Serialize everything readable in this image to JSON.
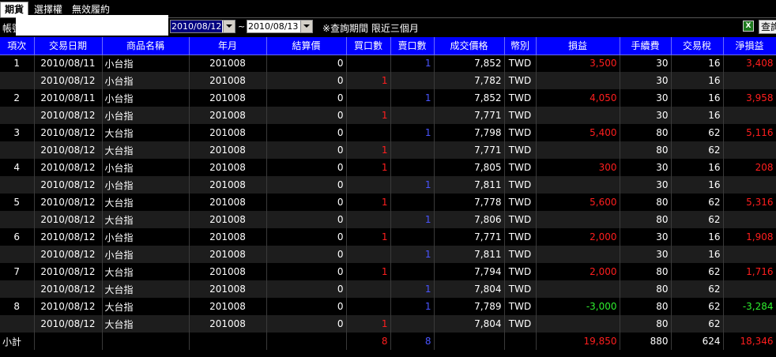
{
  "tabs": [
    "期貨",
    "選擇權",
    "無效履約"
  ],
  "toolbar": {
    "account_label": "帳號",
    "date_from": "2010/08/12",
    "date_separator": "~",
    "date_to": "2010/08/13",
    "note": "※查詢期間 限近三個月",
    "query_label": "查詢"
  },
  "table": {
    "headers": [
      "項次",
      "交易日期",
      "商品名稱",
      "年月",
      "結算價",
      "買口數",
      "賣口數",
      "成交價格",
      "幣別",
      "損益",
      "手續費",
      "交易稅",
      "淨損益"
    ],
    "rows": [
      [
        "1",
        "2010/08/11",
        "小台指",
        "201008",
        "0",
        "",
        "1",
        "7,852",
        "TWD",
        "3,500",
        "30",
        "16",
        "3,408"
      ],
      [
        "",
        "2010/08/12",
        "小台指",
        "201008",
        "0",
        "1",
        "",
        "7,782",
        "TWD",
        "",
        "30",
        "16",
        ""
      ],
      [
        "2",
        "2010/08/11",
        "小台指",
        "201008",
        "0",
        "",
        "1",
        "7,852",
        "TWD",
        "4,050",
        "30",
        "16",
        "3,958"
      ],
      [
        "",
        "2010/08/12",
        "小台指",
        "201008",
        "0",
        "1",
        "",
        "7,771",
        "TWD",
        "",
        "30",
        "16",
        ""
      ],
      [
        "3",
        "2010/08/12",
        "大台指",
        "201008",
        "0",
        "",
        "1",
        "7,798",
        "TWD",
        "5,400",
        "80",
        "62",
        "5,116"
      ],
      [
        "",
        "2010/08/12",
        "大台指",
        "201008",
        "0",
        "1",
        "",
        "7,771",
        "TWD",
        "",
        "80",
        "62",
        ""
      ],
      [
        "4",
        "2010/08/12",
        "小台指",
        "201008",
        "0",
        "1",
        "",
        "7,805",
        "TWD",
        "300",
        "30",
        "16",
        "208"
      ],
      [
        "",
        "2010/08/12",
        "小台指",
        "201008",
        "0",
        "",
        "1",
        "7,811",
        "TWD",
        "",
        "30",
        "16",
        ""
      ],
      [
        "5",
        "2010/08/12",
        "大台指",
        "201008",
        "0",
        "1",
        "",
        "7,778",
        "TWD",
        "5,600",
        "80",
        "62",
        "5,316"
      ],
      [
        "",
        "2010/08/12",
        "大台指",
        "201008",
        "0",
        "",
        "1",
        "7,806",
        "TWD",
        "",
        "80",
        "62",
        ""
      ],
      [
        "6",
        "2010/08/12",
        "小台指",
        "201008",
        "0",
        "1",
        "",
        "7,771",
        "TWD",
        "2,000",
        "30",
        "16",
        "1,908"
      ],
      [
        "",
        "2010/08/12",
        "小台指",
        "201008",
        "0",
        "",
        "1",
        "7,811",
        "TWD",
        "",
        "30",
        "16",
        ""
      ],
      [
        "7",
        "2010/08/12",
        "大台指",
        "201008",
        "0",
        "1",
        "",
        "7,794",
        "TWD",
        "2,000",
        "80",
        "62",
        "1,716"
      ],
      [
        "",
        "2010/08/12",
        "大台指",
        "201008",
        "0",
        "",
        "1",
        "7,804",
        "TWD",
        "",
        "80",
        "62",
        ""
      ],
      [
        "8",
        "2010/08/12",
        "大台指",
        "201008",
        "0",
        "",
        "1",
        "7,789",
        "TWD",
        "-3,000",
        "80",
        "62",
        "-3,284"
      ],
      [
        "",
        "2010/08/12",
        "大台指",
        "201008",
        "0",
        "1",
        "",
        "7,804",
        "TWD",
        "",
        "80",
        "62",
        ""
      ]
    ],
    "total": {
      "label": "小計",
      "buy": "8",
      "sell": "8",
      "pnl": "19,850",
      "fee": "880",
      "tax": "624",
      "net": "18,346"
    }
  },
  "colors": {
    "header_bg": "#0000ff",
    "profit": "#ff1e1e",
    "loss": "#2eee2e",
    "sell_qty": "#4a55ff"
  }
}
